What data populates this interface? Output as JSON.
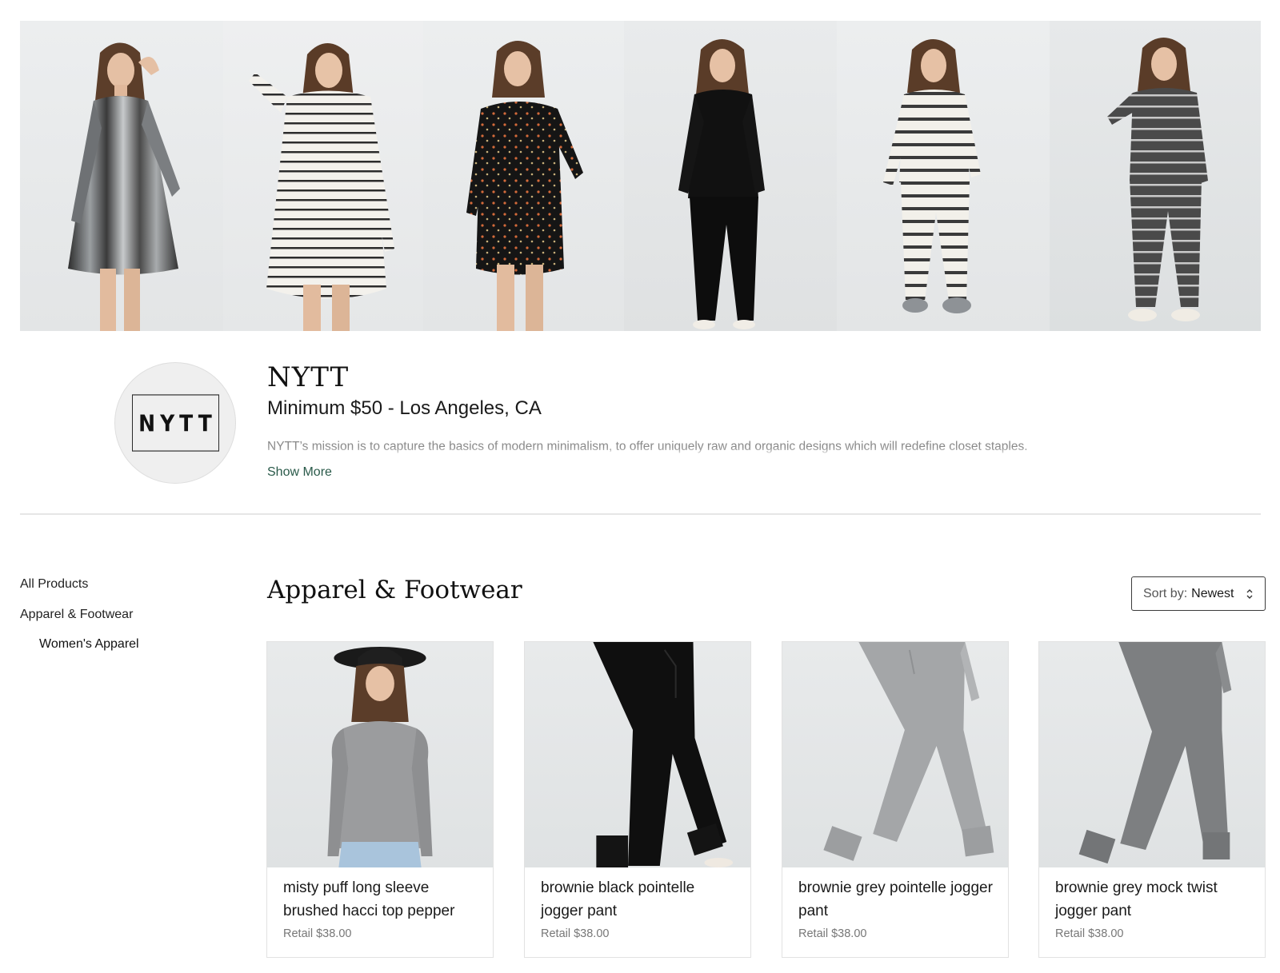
{
  "brand": {
    "logo_text": "NYTT",
    "name": "NYTT",
    "meta": "Minimum $50 - Los Angeles, CA",
    "description": "NYTT’s mission is to capture the basics of modern minimalism, to offer uniquely raw and organic designs which will redefine closet staples.",
    "show_more_label": "Show More"
  },
  "sidebar": {
    "items": [
      {
        "label": "All Products"
      },
      {
        "label": "Apparel & Footwear"
      },
      {
        "label": "Women's Apparel"
      }
    ]
  },
  "main": {
    "title": "Apparel & Footwear",
    "sort": {
      "label": "Sort by:",
      "value": "Newest"
    }
  },
  "products": [
    {
      "name": "misty puff long sleeve brushed hacci top pepper",
      "price": "Retail $38.00"
    },
    {
      "name": "brownie black pointelle jogger pant",
      "price": "Retail $38.00"
    },
    {
      "name": "brownie grey pointelle jogger pant",
      "price": "Retail $38.00"
    },
    {
      "name": "brownie grey mock twist jogger pant",
      "price": "Retail $38.00"
    }
  ]
}
